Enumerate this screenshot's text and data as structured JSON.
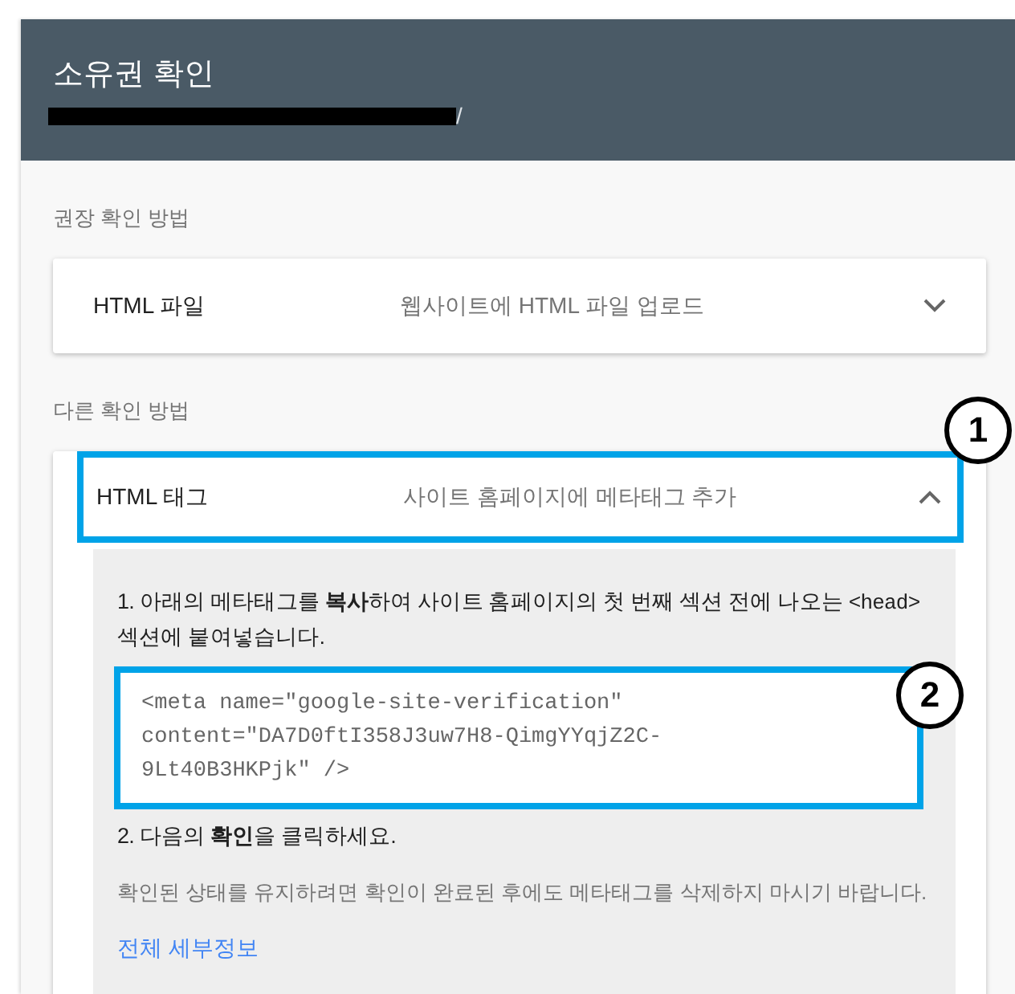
{
  "header": {
    "title": "소유권 확인",
    "url_redacted": true,
    "url_visible": "/"
  },
  "sections": [
    {
      "label": "권장 확인 방법",
      "methods": [
        {
          "title": "HTML 파일",
          "description": "웹사이트에 HTML 파일 업로드",
          "expanded": false,
          "highlighted": false
        }
      ]
    },
    {
      "label": "다른 확인 방법",
      "methods": [
        {
          "title": "HTML 태그",
          "description": "사이트 홈페이지에 메타태그 추가",
          "expanded": true,
          "highlighted": true,
          "callout": "1",
          "details": {
            "step1": [
              {
                "kind": "text",
                "text": "1. 아래의 메타태그를 **복사**하여 사이트 홈페이지의 첫 번째 섹션 전에 나오는 "
              },
              {
                "kind": "code",
                "text": "<head>"
              },
              {
                "kind": "text",
                "text": " 섹션에 붙여넣습니다."
              }
            ],
            "code": {
              "lines": [
                "<meta name=\"google-site-verification\"",
                "content=\"DA7D0ftI358J3uw7H8-QimgYYqjZ2C-",
                "9Lt40B3HKPjk\" />"
              ],
              "highlighted": true,
              "callout": "2"
            },
            "step2": "2. 다음의 **확인**을 클릭하세요.",
            "note": "확인된 상태를 유지하려면 확인이 완료된 후에도 메타태그를 삭제하지 마시기 바랍니다.",
            "link": "전체 세부정보"
          }
        }
      ]
    }
  ]
}
